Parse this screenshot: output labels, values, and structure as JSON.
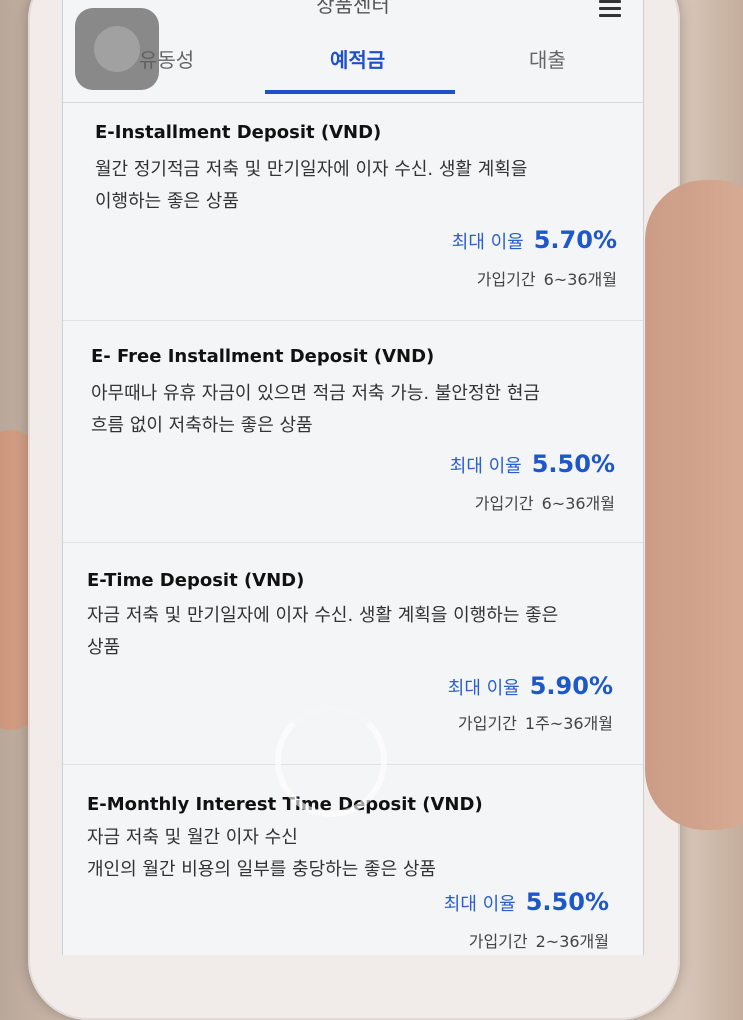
{
  "header": {
    "title": "상품센터"
  },
  "tabs": [
    {
      "label": "유동성"
    },
    {
      "label": "예적금"
    },
    {
      "label": "대출"
    }
  ],
  "rate_label": "최대 이율",
  "term_label": "가입기간",
  "products": [
    {
      "title": "E-Installment Deposit (VND)",
      "desc_line1": "월간 정기적금 저축 및 만기일자에 이자 수신. 생활 계획을",
      "desc_line2": "이행하는 좋은 상품",
      "rate": "5.70%",
      "term": "6~36개월"
    },
    {
      "title": "E- Free Installment Deposit (VND)",
      "desc_line1": "아무때나 유휴 자금이 있으면 적금 저축 가능. 불안정한 현금",
      "desc_line2": "흐름 없이 저축하는 좋은 상품",
      "rate": "5.50%",
      "term": "6~36개월"
    },
    {
      "title": "E-Time Deposit (VND)",
      "desc_line1": "자금 저축 및 만기일자에 이자 수신. 생활 계획을 이행하는 좋은",
      "desc_line2": "상품",
      "rate": "5.90%",
      "term": "1주~36개월"
    },
    {
      "title": "E-Monthly Interest Time Deposit (VND)",
      "desc_line1": "자금 저축 및 월간 이자 수신",
      "desc_line2": "개인의 월간 비용의 일부를 충당하는 좋은 상품",
      "rate": "5.50%",
      "term": "2~36개월"
    }
  ],
  "colors": {
    "accent": "#1f50c9",
    "rate": "#1d57c9"
  }
}
